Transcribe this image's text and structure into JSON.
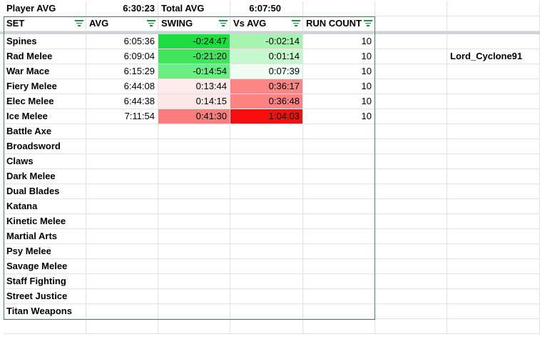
{
  "summary": {
    "player_avg_label": "Player AVG",
    "player_avg_value": "6:30:23",
    "total_avg_label": "Total AVG",
    "total_avg_value": "6:07:50"
  },
  "table": {
    "headers": [
      "SET",
      "AVG",
      "SWING",
      "Vs AVG",
      "RUN COUNT"
    ],
    "rows": [
      {
        "set": "Spines",
        "avg": "6:05:36",
        "swing": "-0:24:47",
        "vs_avg": "-0:02:14",
        "run_count": "10",
        "swing_color": "#1fdc40",
        "vs_color": "#a7f4b1"
      },
      {
        "set": "Rad Melee",
        "avg": "6:09:04",
        "swing": "-0:21:20",
        "vs_avg": "0:01:14",
        "run_count": "10",
        "swing_color": "#3fe65c",
        "vs_color": "#c6f8cd"
      },
      {
        "set": "War Mace",
        "avg": "6:15:29",
        "swing": "-0:14:54",
        "vs_avg": "0:07:39",
        "run_count": "10",
        "swing_color": "#6ded82",
        "vs_color": "#f0fdf2"
      },
      {
        "set": "Fiery Melee",
        "avg": "6:44:08",
        "swing": "0:13:44",
        "vs_avg": "0:36:17",
        "run_count": "10",
        "swing_color": "#fdeaea",
        "vs_color": "#fc8585"
      },
      {
        "set": "Elec Melee",
        "avg": "6:44:38",
        "swing": "0:14:15",
        "vs_avg": "0:36:48",
        "run_count": "10",
        "swing_color": "#fde8e8",
        "vs_color": "#fc8383"
      },
      {
        "set": "Ice Melee",
        "avg": "7:11:54",
        "swing": "0:41:30",
        "vs_avg": "1:04:03",
        "run_count": "10",
        "swing_color": "#fa7d7d",
        "vs_color": "#f90e0e"
      },
      {
        "set": "Battle Axe"
      },
      {
        "set": "Broadsword"
      },
      {
        "set": "Claws"
      },
      {
        "set": "Dark Melee"
      },
      {
        "set": "Dual Blades"
      },
      {
        "set": "Katana"
      },
      {
        "set": "Kinetic Melee"
      },
      {
        "set": "Martial Arts"
      },
      {
        "set": "Psy Melee"
      },
      {
        "set": "Savage Melee"
      },
      {
        "set": "Staff Fighting"
      },
      {
        "set": "Street Justice"
      },
      {
        "set": "Titan Weapons"
      }
    ]
  },
  "side_label": "Lord_Cyclone91",
  "colors": {
    "table_border": "#3f8f5d",
    "filter_icon": "#1e8e3e",
    "grid": "#e2e2e2"
  }
}
